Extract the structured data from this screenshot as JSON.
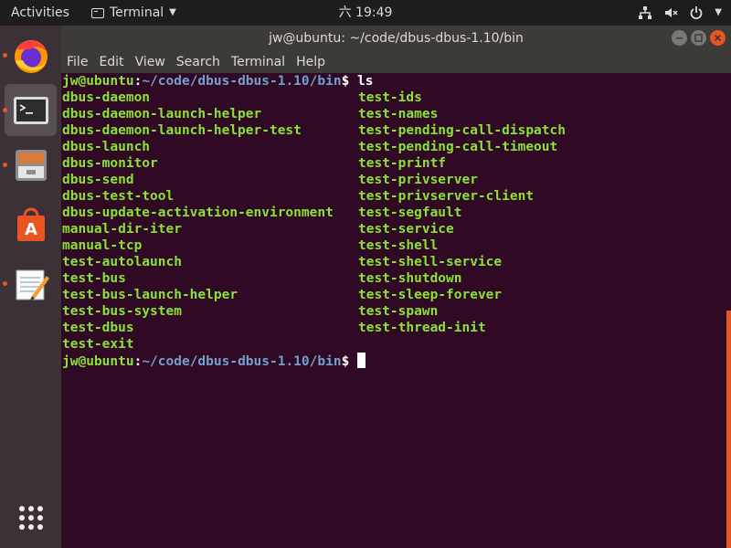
{
  "topbar": {
    "activities": "Activities",
    "app_name": "Terminal",
    "clock": "六 19:49"
  },
  "window": {
    "title": "jw@ubuntu: ~/code/dbus-dbus-1.10/bin",
    "menu": [
      "File",
      "Edit",
      "View",
      "Search",
      "Terminal",
      "Help"
    ]
  },
  "terminal": {
    "prompt_user": "jw@ubuntu",
    "prompt_path": "~/code/dbus-dbus-1.10/bin",
    "prompt_symbol": "$",
    "command": "ls",
    "col1": [
      "dbus-daemon",
      "dbus-daemon-launch-helper",
      "dbus-daemon-launch-helper-test",
      "dbus-launch",
      "dbus-monitor",
      "dbus-send",
      "dbus-test-tool",
      "dbus-update-activation-environment",
      "manual-dir-iter",
      "manual-tcp",
      "test-autolaunch",
      "test-bus",
      "test-bus-launch-helper",
      "test-bus-system",
      "test-dbus",
      "test-exit"
    ],
    "col2": [
      "test-ids",
      "test-names",
      "test-pending-call-dispatch",
      "test-pending-call-timeout",
      "test-printf",
      "test-privserver",
      "test-privserver-client",
      "test-segfault",
      "test-service",
      "test-shell",
      "test-shell-service",
      "test-shutdown",
      "test-sleep-forever",
      "test-spawn",
      "test-thread-init"
    ]
  },
  "dock": [
    "firefox-icon",
    "terminal-icon",
    "files-icon",
    "software-icon",
    "text-editor-icon",
    "show-apps-icon"
  ],
  "colors": {
    "accent": "#e95420",
    "terminal_bg": "#300a24",
    "file_green": "#8ae234",
    "path_blue": "#729fcf"
  }
}
